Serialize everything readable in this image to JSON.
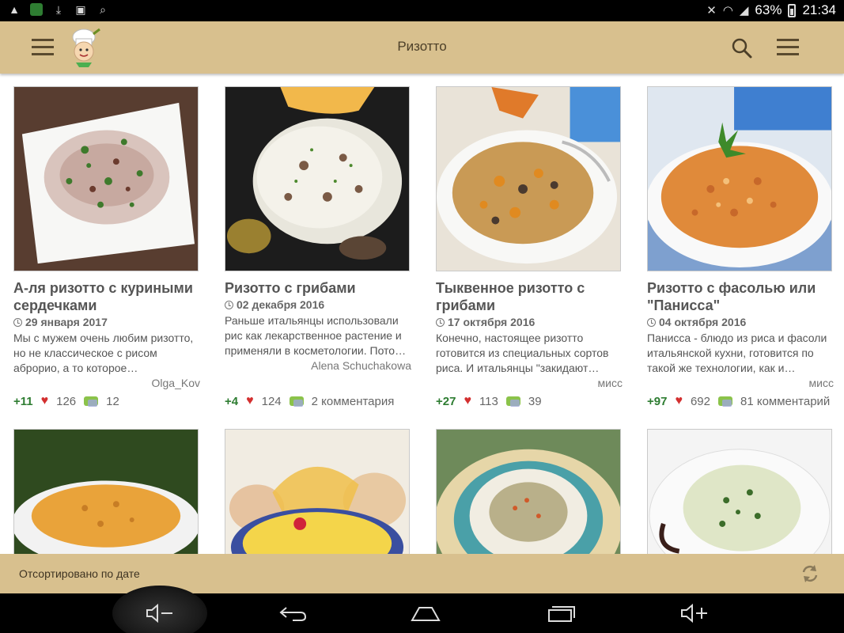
{
  "status_bar": {
    "battery": "63%",
    "time": "21:34"
  },
  "app_bar": {
    "title": "Ризотто"
  },
  "recipes": [
    {
      "title": "А-ля ризотто с куриными сердечками",
      "date": "29 января 2017",
      "description": "Мы с мужем очень любим ризотто, но не классическое с рисом аброрио, а то которое…",
      "author": "Olga_Kov",
      "rating": "+11",
      "likes": "126",
      "comments": "12"
    },
    {
      "title": "Ризотто с грибами",
      "date": "02 декабря 2016",
      "description": "Раньше итальянцы использовали рис как лекарственное растение и применяли в косметологии. Пото…",
      "author": "Alena Schuchakowa",
      "rating": "+4",
      "likes": "124",
      "comments": "2 комментария"
    },
    {
      "title": "Тыквенное ризотто с грибами",
      "date": "17 октября 2016",
      "description": "Конечно, настоящее ризотто готовится из специальных сортов риса. И итальянцы \"закидают…",
      "author": "мисс",
      "rating": "+27",
      "likes": "113",
      "comments": "39"
    },
    {
      "title": "Ризотто с фасолью или \"Панисса\"",
      "date": "04 октября 2016",
      "description": "Панисса - блюдо из риса и фасоли итальянской кухни, готовится по такой же технологии, как и…",
      "author": "мисс",
      "rating": "+97",
      "likes": "692",
      "comments": "81 комментарий"
    }
  ],
  "sort_bar": {
    "label": "Отсортировано по дате"
  },
  "icons": {
    "menu": "hamburger-icon",
    "logo": "chef-logo",
    "search": "search-icon",
    "overflow": "menu-icon",
    "refresh": "refresh-icon",
    "clock": "clock-icon",
    "heart": "heart-icon",
    "comment": "comment-icon"
  },
  "colors": {
    "app_bar": "#d8c08e",
    "rating_positive": "#2e7d32",
    "heart": "#d32f2f"
  }
}
